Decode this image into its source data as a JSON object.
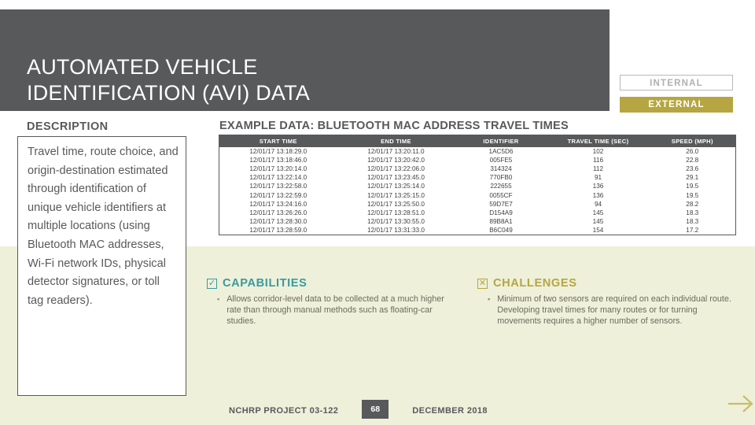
{
  "slide": {
    "title_line1": "AUTOMATED VEHICLE",
    "title_line2": "IDENTIFICATION (AVI) DATA"
  },
  "badges": {
    "internal": "INTERNAL",
    "external": "EXTERNAL",
    "external_color": "#b5a642",
    "internal_text_color": "#b0b0b0"
  },
  "description": {
    "heading": "DESCRIPTION",
    "body": "Travel time, route choice, and origin-destination estimated through identification of unique vehicle identifiers at multiple locations (using Bluetooth MAC addresses, Wi-Fi network IDs, physical detector signatures, or toll tag readers)."
  },
  "example_data": {
    "heading": "EXAMPLE DATA: BLUETOOTH MAC ADDRESS TRAVEL TIMES",
    "columns": [
      "START TIME",
      "END TIME",
      "IDENTIFIER",
      "TRAVEL TIME (SEC)",
      "SPEED (MPH)"
    ],
    "rows": [
      [
        "12/01/17 13:18:29.0",
        "12/01/17 13:20:11.0",
        "1AC5D6",
        "102",
        "26.0"
      ],
      [
        "12/01/17 13:18:46.0",
        "12/01/17 13:20:42.0",
        "005FE5",
        "116",
        "22.8"
      ],
      [
        "12/01/17 13:20:14.0",
        "12/01/17 13:22:06.0",
        "314324",
        "112",
        "23.6"
      ],
      [
        "12/01/17 13:22:14.0",
        "12/01/17 13:23:45.0",
        "770FB0",
        "91",
        "29.1"
      ],
      [
        "12/01/17 13:22:58.0",
        "12/01/17 13:25:14.0",
        "222655",
        "136",
        "19.5"
      ],
      [
        "12/01/17 13:22:59.0",
        "12/01/17 13:25:15.0",
        "0055CF",
        "136",
        "19.5"
      ],
      [
        "12/01/17 13:24:16.0",
        "12/01/17 13:25:50.0",
        "59D7E7",
        "94",
        "28.2"
      ],
      [
        "12/01/17 13:26:26.0",
        "12/01/17 13:28:51.0",
        "D154A9",
        "145",
        "18.3"
      ],
      [
        "12/01/17 13:28:30.0",
        "12/01/17 13:30:55.0",
        "89B8A1",
        "145",
        "18.3"
      ],
      [
        "12/01/17 13:28:59.0",
        "12/01/17 13:31:33.0",
        "B6C049",
        "154",
        "17.2"
      ]
    ]
  },
  "capabilities": {
    "icon": "checked-box-icon",
    "icon_glyph": "✓",
    "title": "CAPABILITIES",
    "color": "#3a9aa0",
    "bullet_marker": "▪",
    "items": [
      "Allows corridor-level data to be collected at a much higher rate than through manual methods such as floating-car studies."
    ]
  },
  "challenges": {
    "icon": "x-box-icon",
    "icon_glyph": "✕",
    "title": "CHALLENGES",
    "color": "#b5a642",
    "bullet_marker": "▪",
    "items": [
      "Minimum of two sensors are required on each individual route. Developing travel times for many routes or for turning movements requires a higher number of sensors."
    ]
  },
  "footer": {
    "project": "NCHRP PROJECT 03-122",
    "page": "68",
    "date": "DECEMBER 2018"
  },
  "next_arrow": {
    "icon": "arrow-right-icon",
    "color": "#c8bd6a"
  }
}
